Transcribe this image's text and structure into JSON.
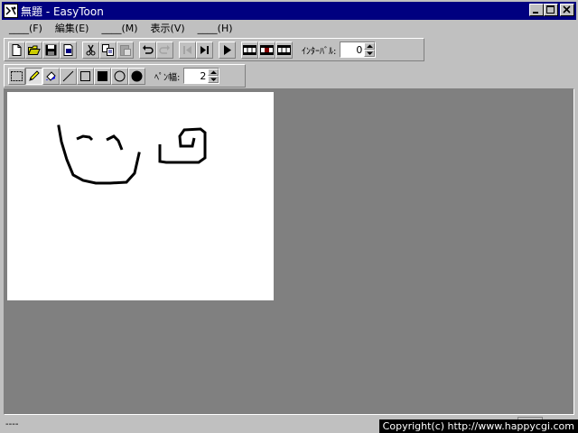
{
  "window": {
    "title": "無題 - EasyToon"
  },
  "menu": {
    "items": [
      "____(F)",
      "編集(E)",
      "____(M)",
      "表示(V)",
      "____(H)"
    ]
  },
  "toolbar1": {
    "buttons": [
      {
        "name": "new-icon"
      },
      {
        "name": "open-icon"
      },
      {
        "name": "save-icon"
      },
      {
        "name": "export-icon"
      },
      {
        "name": "cut-icon"
      },
      {
        "name": "copy-icon"
      },
      {
        "name": "paste-icon"
      },
      {
        "name": "undo-icon"
      },
      {
        "name": "redo-icon"
      },
      {
        "name": "prev-frame-icon"
      },
      {
        "name": "next-frame-icon"
      },
      {
        "name": "play-icon"
      },
      {
        "name": "film-icon"
      },
      {
        "name": "film-insert-icon"
      },
      {
        "name": "film-delete-icon"
      }
    ],
    "interval_label": "ｲﾝﾀｰﾊﾞﾙ:",
    "interval_value": "0"
  },
  "toolbar2": {
    "tools": [
      {
        "name": "select-icon"
      },
      {
        "name": "pencil-icon"
      },
      {
        "name": "fill-icon"
      },
      {
        "name": "line-icon"
      },
      {
        "name": "rect-icon"
      },
      {
        "name": "filled-rect-icon"
      },
      {
        "name": "ellipse-icon"
      },
      {
        "name": "filled-ellipse-icon"
      }
    ],
    "pen_width_label": "ﾍﾟﾝ幅:",
    "pen_width_value": "2"
  },
  "status": {
    "text": "----",
    "copyright": "Copyright(c) http://www.happycgi.com"
  }
}
